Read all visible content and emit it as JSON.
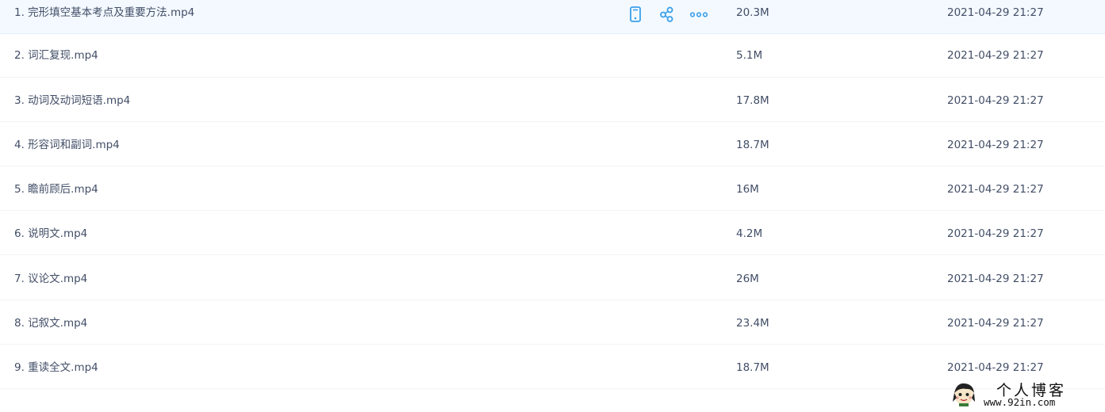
{
  "files": [
    {
      "name": "1. 完形填空基本考点及重要方法.mp4",
      "size": "20.3M",
      "date": "2021-04-29 21:27"
    },
    {
      "name": "2. 词汇复现.mp4",
      "size": "5.1M",
      "date": "2021-04-29 21:27"
    },
    {
      "name": "3. 动词及动词短语.mp4",
      "size": "17.8M",
      "date": "2021-04-29 21:27"
    },
    {
      "name": "4. 形容词和副词.mp4",
      "size": "18.7M",
      "date": "2021-04-29 21:27"
    },
    {
      "name": "5. 瞻前顾后.mp4",
      "size": "16M",
      "date": "2021-04-29 21:27"
    },
    {
      "name": "6. 说明文.mp4",
      "size": "4.2M",
      "date": "2021-04-29 21:27"
    },
    {
      "name": "7. 议论文.mp4",
      "size": "26M",
      "date": "2021-04-29 21:27"
    },
    {
      "name": "8. 记叙文.mp4",
      "size": "23.4M",
      "date": "2021-04-29 21:27"
    },
    {
      "name": "9. 重读全文.mp4",
      "size": "18.7M",
      "date": "2021-04-29 21:27"
    }
  ],
  "row_actions": {
    "icons": [
      "phone-icon",
      "share-icon",
      "more-icon"
    ],
    "color": "#3b9fe8"
  },
  "watermark": {
    "title": "个人博客",
    "url": "www.92in.com"
  },
  "colors": {
    "text": "#424e67",
    "hover_row": "#f3f9ff",
    "divider": "#f2f4f7",
    "accent": "#3b9fe8"
  }
}
